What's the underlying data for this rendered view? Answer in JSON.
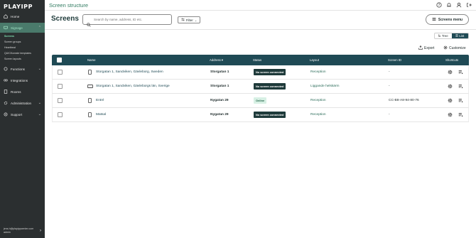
{
  "app": {
    "logo": "PLAYIPP",
    "breadcrumb_title": "Screen structure"
  },
  "sidebar": {
    "items": [
      {
        "label": "Home",
        "icon": "home-icon"
      },
      {
        "label": "Signage",
        "icon": "signage-icon",
        "expanded": true
      },
      {
        "label": "Functions",
        "icon": "functions-icon"
      },
      {
        "label": "Integrations",
        "icon": "integrations-icon"
      },
      {
        "label": "Rooms",
        "icon": "rooms-icon"
      },
      {
        "label": "Administration",
        "icon": "administration-icon"
      },
      {
        "label": "Support",
        "icon": "support-icon"
      }
    ],
    "signage_sub": [
      "Screens",
      "Screen groups",
      "Heartbeat",
      "QUICKcreate templates",
      "Screen layouts"
    ],
    "user_email": "jens.h@playippcenter.com",
    "user_sub": "admin"
  },
  "header": {
    "page_title": "Screens",
    "search_placeholder": "Search by name, address, ID etc.",
    "filter_label": "Filter",
    "screens_menu_label": "Screens menu"
  },
  "view": {
    "tree_label": "Tree",
    "list_label": "List",
    "active": "List"
  },
  "actions": {
    "export_label": "Export",
    "customize_label": "Customize"
  },
  "table": {
    "columns": [
      "Name",
      "Address",
      "Status",
      "Layout",
      "Screen ID",
      "Shortcuts"
    ],
    "address_sort_indicator": "▾",
    "rows": [
      {
        "name": "Storgatan 1, Sandviken, Gävleborg, Sweden",
        "device": "portrait",
        "address": "Storgatan 1",
        "status": "No screen connected",
        "status_type": "off",
        "layout": "Reception",
        "screen_id": "-"
      },
      {
        "name": "Storgatan 1, Sandviken, Gävleborgs län, Sverige",
        "device": "landscape",
        "address": "Storgatan 1",
        "status": "No screen connected",
        "status_type": "off",
        "layout": "Liggande helskärm",
        "screen_id": "-"
      },
      {
        "name": "Entré",
        "device": "portrait",
        "address": "Nygatan 29",
        "status": "Online",
        "status_type": "on",
        "layout": "Reception",
        "screen_id": "CC-B8-A8-94-80-76"
      },
      {
        "name": "Matsal",
        "device": "portrait",
        "address": "Nygatan 29",
        "status": "No screen connected",
        "status_type": "off",
        "layout": "Reception",
        "screen_id": "-"
      }
    ]
  },
  "colors": {
    "brand_dark": "#1f4a55",
    "brand_green": "#2f7a5f",
    "sidebar_bg": "#2b2f30",
    "online_bg": "#d7f0e4"
  }
}
